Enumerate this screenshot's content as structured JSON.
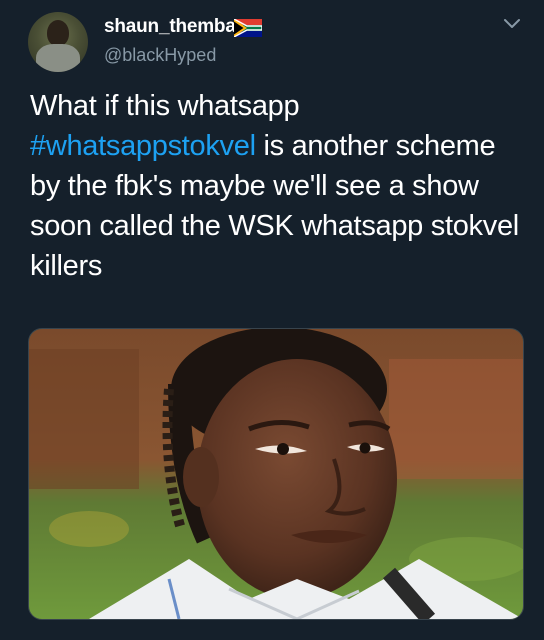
{
  "tweet": {
    "author": {
      "display_name": "shaun_themba",
      "handle": "@blackHyped",
      "avatar_icon": "profile-avatar",
      "flag_icon": "south-africa-flag-icon"
    },
    "menu_icon": "chevron-down-icon",
    "text_before_hashtag": "What if this whatsapp",
    "hashtag": "#whatsappstokvel",
    "text_after_hashtag": "is another scheme by the fbk's maybe we'll see a show soon called the WSK whatsapp stokvel killers",
    "media": {
      "kind": "photo",
      "description_icon": "photo-image"
    }
  },
  "colors": {
    "background": "#15202b",
    "text": "#ffffff",
    "secondary_text": "#8899a6",
    "link": "#1da1f2"
  }
}
